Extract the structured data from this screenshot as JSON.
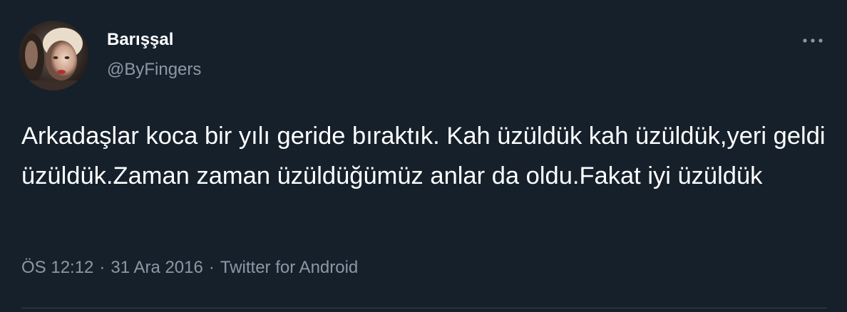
{
  "user": {
    "display_name": "Barışşal",
    "handle": "@ByFingers",
    "avatar_icon": "profile-photo"
  },
  "more_icon": "ellipsis-icon",
  "tweet": {
    "text": "Arkadaşlar koca bir yılı geride bıraktık. Kah üzüldük kah üzüldük,yeri geldi üzüldük.Zaman zaman üzüldüğümüz anlar da oldu.Fakat iyi üzüldük"
  },
  "meta": {
    "time": "ÖS 12:12",
    "separator": "·",
    "date": "31 Ara 2016",
    "source": "Twitter for Android"
  },
  "colors": {
    "background": "#15202b",
    "primary_text": "#ffffff",
    "secondary_text": "#8b98a5",
    "divider": "#38444d"
  }
}
